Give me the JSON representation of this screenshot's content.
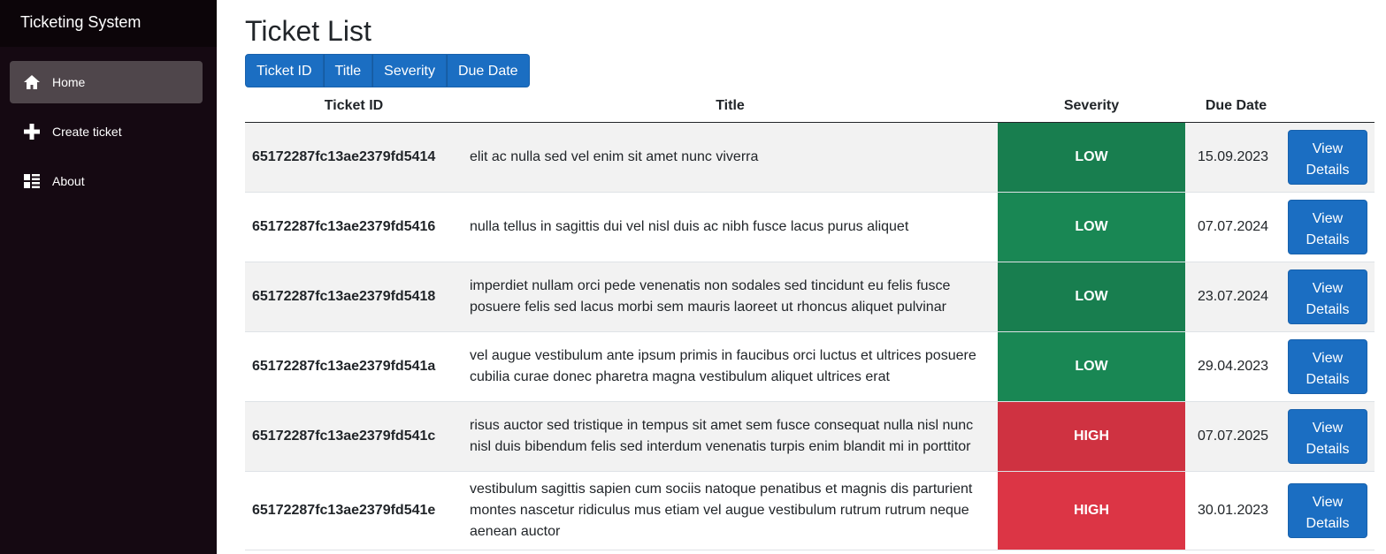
{
  "app": {
    "title": "Ticketing System"
  },
  "sidebar": {
    "items": [
      {
        "label": "Home",
        "icon": "home-icon",
        "active": true
      },
      {
        "label": "Create ticket",
        "icon": "plus-icon",
        "active": false
      },
      {
        "label": "About",
        "icon": "list-icon",
        "active": false
      }
    ]
  },
  "page": {
    "title": "Ticket List"
  },
  "sort_buttons": [
    "Ticket ID",
    "Title",
    "Severity",
    "Due Date"
  ],
  "table": {
    "headers": {
      "id": "Ticket ID",
      "title": "Title",
      "severity": "Severity",
      "due": "Due Date"
    },
    "view_label_line1": "View",
    "view_label_line2": "Details",
    "rows": [
      {
        "id": "65172287fc13ae2379fd5414",
        "title": "elit ac nulla sed vel enim sit amet nunc viverra",
        "severity": "LOW",
        "due": "15.09.2023"
      },
      {
        "id": "65172287fc13ae2379fd5416",
        "title": "nulla tellus in sagittis dui vel nisl duis ac nibh fusce lacus purus aliquet",
        "severity": "LOW",
        "due": "07.07.2024"
      },
      {
        "id": "65172287fc13ae2379fd5418",
        "title": "imperdiet nullam orci pede venenatis non sodales sed tincidunt eu felis fusce posuere felis sed lacus morbi sem mauris laoreet ut rhoncus aliquet pulvinar",
        "severity": "LOW",
        "due": "23.07.2024"
      },
      {
        "id": "65172287fc13ae2379fd541a",
        "title": "vel augue vestibulum ante ipsum primis in faucibus orci luctus et ultrices posuere cubilia curae donec pharetra magna vestibulum aliquet ultrices erat",
        "severity": "LOW",
        "due": "29.04.2023"
      },
      {
        "id": "65172287fc13ae2379fd541c",
        "title": "risus auctor sed tristique in tempus sit amet sem fusce consequat nulla nisl nunc nisl duis bibendum felis sed interdum venenatis turpis enim blandit mi in porttitor",
        "severity": "HIGH",
        "due": "07.07.2025"
      },
      {
        "id": "65172287fc13ae2379fd541e",
        "title": "vestibulum sagittis sapien cum sociis natoque penatibus et magnis dis parturient montes nascetur ridiculus mus etiam vel augue vestibulum rutrum rutrum neque aenean auctor",
        "severity": "HIGH",
        "due": "30.01.2023"
      }
    ]
  },
  "colors": {
    "sidebar_bg": "#150912",
    "accent": "#1b6ec2",
    "severity_low": "#198754",
    "severity_high": "#dc3545"
  }
}
